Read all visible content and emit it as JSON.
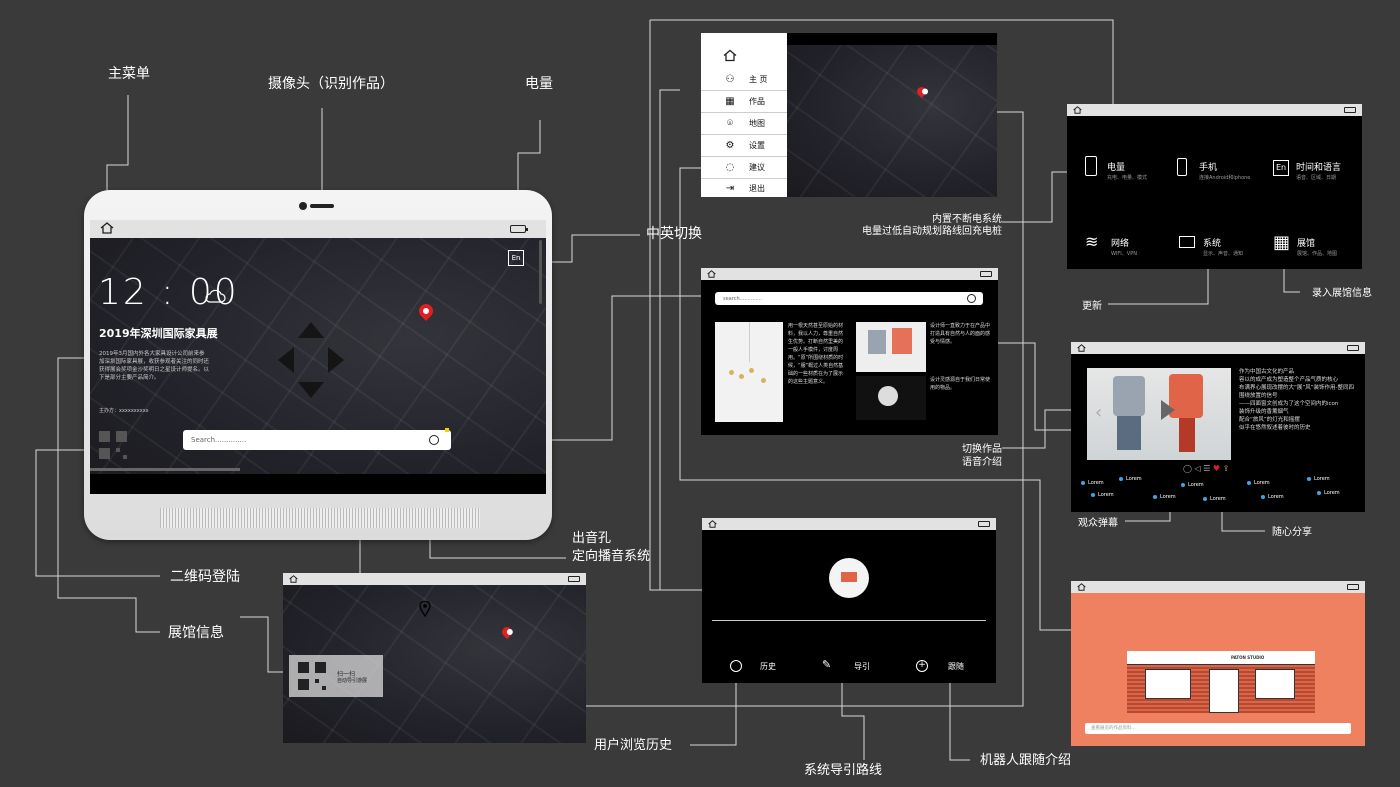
{
  "callouts": {
    "main_menu": "主菜单",
    "camera": "摄像头（识别作品）",
    "battery": "电量",
    "lang_switch": "中英切换",
    "speaker": "出音孔",
    "speaker2": "定向播音系统",
    "qr_login": "二维码登陆",
    "hall_info": "展馆信息",
    "power": "内置不断电系统",
    "power2": "电量过低自动规划路线回充电桩",
    "update": "更新",
    "enter_hall": "录入展馆信息",
    "switch_work": "切换作品",
    "switch_work2": "语音介绍",
    "danmaku": "观众弹幕",
    "share": "随心分享",
    "history": "用户浏览历史",
    "guide": "系统导引路线",
    "follow": "机器人跟随介绍"
  },
  "tablet": {
    "time": "12 : 00",
    "event_title": "2019年深圳国际家具展",
    "event_desc": "2019年3月国内外各大家具设计公司前来参加深圳国际家具展，收获参观者关注的同时还获得展会奖项金沙奖明日之星设计师提名。以下是部分主要产品简介。",
    "host": "主办方：",
    "host_value": "xxxxxxxxxx",
    "search_placeholder": "Search..............",
    "lang_icon": "En"
  },
  "menu": {
    "items": [
      {
        "icon": "user-icon",
        "label": "主 页"
      },
      {
        "icon": "grid-icon",
        "label": "作品"
      },
      {
        "icon": "map-pin-icon",
        "label": "地图"
      },
      {
        "icon": "gear-icon",
        "label": "设置"
      },
      {
        "icon": "chat-icon",
        "label": "建议"
      },
      {
        "icon": "exit-icon",
        "label": "退出"
      }
    ]
  },
  "settings": {
    "items": [
      {
        "label": "电量",
        "sub": "充电、电量、模式"
      },
      {
        "label": "手机",
        "sub": "连接Android和iphone"
      },
      {
        "label": "时间和语言",
        "sub": "语音、区域、日期"
      },
      {
        "label": "网络",
        "sub": "WIFI、VPN"
      },
      {
        "label": "系统",
        "sub": "显示、声音、通知"
      },
      {
        "label": "展馆",
        "sub": "展馆、作品、地图"
      }
    ]
  },
  "works": {
    "search_placeholder": "search..............",
    "desc1": "用一根天然甚至原始的材料，我以人力，尊重自然生优势。打断自然里美的一般人手模件，讨度周用。“原”所围绕材质的时候，“服”概过人类自然基础的一些材质在为了展示的这些主题意义。",
    "desc2": "设计师一直致力于在产品中打造具有自然与人的面的感受与情感。",
    "desc3": "设计灵感源自于我们日常使用的物品。"
  },
  "detail": {
    "desc": "作为中国古文化的产品\n容以的成产成为塑造整个产品气质的核心\n布满界心展现改摆的大“展”风”装饰作用-整同四围绕放置的信号\n——四面窗文创成为了这个空间内的icon\n装饰升级的香薰烟气\n配合“旅风”的灯光和摇摆\n似乎在悠然叙述着彼时的历史",
    "lorem": "Lorem"
  },
  "guide": {
    "history": "历史",
    "guide": "导引",
    "follow": "跟随"
  },
  "qr_screen": {
    "scan": "扫一扫",
    "auto": "自动导引游展"
  },
  "store": {
    "sign": "PATON STUDIO",
    "input_placeholder": "查看展览的作品资料..."
  },
  "colors": {
    "bg": "#3a3a3a",
    "pin": "#e02020",
    "salmon": "#ef8060",
    "accent_blue": "#38a6e8"
  }
}
